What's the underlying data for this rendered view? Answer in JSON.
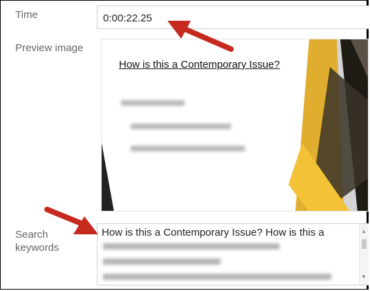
{
  "fields": {
    "time_label": "Time",
    "time_value": "0:00:22.25",
    "preview_label": "Preview image",
    "search_label_line1": "Search",
    "search_label_line2": "keywords"
  },
  "slide": {
    "title": "How is this a Contemporary Issue?"
  },
  "keywords": {
    "visible_text": "How is this a Contemporary Issue? How is this a"
  },
  "colors": {
    "annotation_arrow": "#c62a1f",
    "slide_gold": "#e0ad2e",
    "slide_dark": "#1e1a14"
  },
  "icons": {
    "scroll_up": "▲",
    "scroll_down": "▼"
  }
}
